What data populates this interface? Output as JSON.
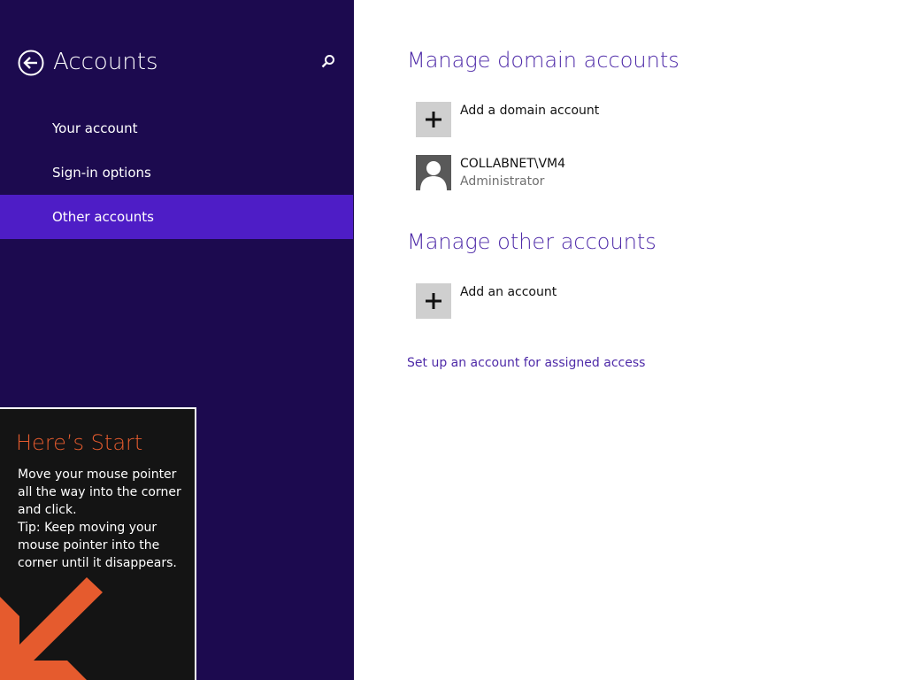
{
  "colors": {
    "left_pane_bg": "#1c0a4f",
    "selected_nav_bg": "#4e1dc6",
    "accent_text": "#4e2aa8",
    "tile_gray": "#cfcfcf",
    "avatar_bg": "#595959",
    "tip_bg": "#141414",
    "tip_accent": "#e55b2e"
  },
  "left": {
    "back_icon": "back-arrow-circle-icon",
    "title": "Accounts",
    "search_icon": "search-icon",
    "nav": [
      {
        "label": "Your account",
        "selected": false
      },
      {
        "label": "Sign-in options",
        "selected": false
      },
      {
        "label": "Other accounts",
        "selected": true
      }
    ]
  },
  "tip": {
    "title": "Here’s Start",
    "body": "Move your mouse pointer all the way into the corner and click.\nTip: Keep moving your mouse pointer into the corner until it disappears.",
    "arrow_icon": "corner-arrow-icon"
  },
  "main": {
    "domain_section": {
      "title": "Manage domain accounts",
      "add_label": "Add a domain account",
      "accounts": [
        {
          "name": "COLLABNET\\VM4",
          "role": "Administrator",
          "icon": "user-avatar-icon"
        }
      ]
    },
    "other_section": {
      "title": "Manage other accounts",
      "add_label": "Add an account"
    },
    "assigned_access_link": "Set up an account for assigned access"
  }
}
